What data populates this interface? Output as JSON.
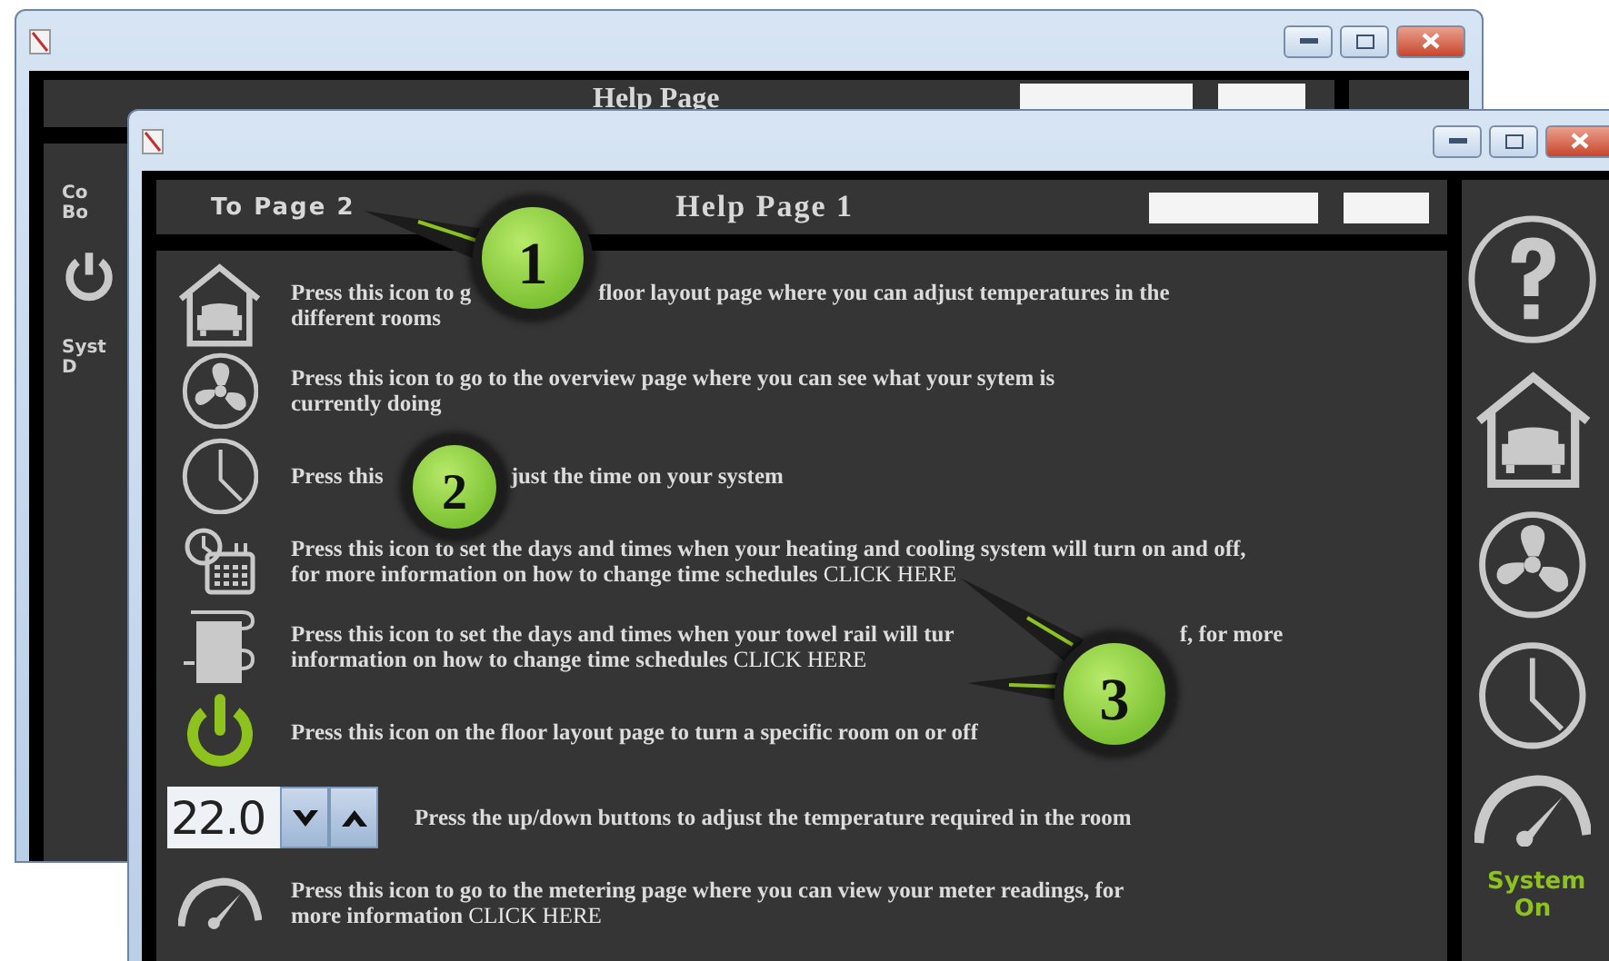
{
  "back_window": {
    "header": {
      "title": "Help Page"
    },
    "side_fragments": [
      "Co",
      "Bo",
      "Syst",
      "D"
    ]
  },
  "front_window": {
    "header": {
      "nav_button": "To Page 2",
      "title": "Help Page 1"
    },
    "help_rows": [
      {
        "kind": "floor-layout",
        "text": [
          "Press this icon to g",
          "floor layout page where you can adjust temperatures in the\ndifferent rooms"
        ]
      },
      {
        "kind": "overview",
        "text": "Press this icon to go to the overview page where you can see what your sytem is\ncurrently doing"
      },
      {
        "kind": "time",
        "text": [
          "Press this",
          "just the time on your system"
        ]
      },
      {
        "kind": "schedule",
        "text": "Press this icon to set the days and times when your heating and cooling system will turn on and off,\nfor more information on how to change time schedules ",
        "link": "CLICK HERE"
      },
      {
        "kind": "towel-rail",
        "text": [
          "Press this icon to set the days and times when your towel rail will tur",
          "f, for more\ninformation on how to change time schedules "
        ],
        "link": "CLICK HERE"
      },
      {
        "kind": "power",
        "text": "Press this icon on the floor layout page to turn a specific room on or off"
      },
      {
        "kind": "temperature",
        "value": "22.0",
        "text": "Press the up/down buttons to adjust the temperature required in the room"
      },
      {
        "kind": "metering",
        "text": "Press this icon to go to the metering page where you can view your meter readings, for\nmore information ",
        "link": "CLICK HERE"
      }
    ],
    "sidebar": {
      "items": [
        {
          "kind": "help"
        },
        {
          "kind": "floor-layout"
        },
        {
          "kind": "overview"
        },
        {
          "kind": "time"
        },
        {
          "kind": "metering"
        }
      ],
      "status": "System On"
    }
  },
  "callouts": [
    {
      "number": "1"
    },
    {
      "number": "2"
    },
    {
      "number": "3"
    }
  ]
}
